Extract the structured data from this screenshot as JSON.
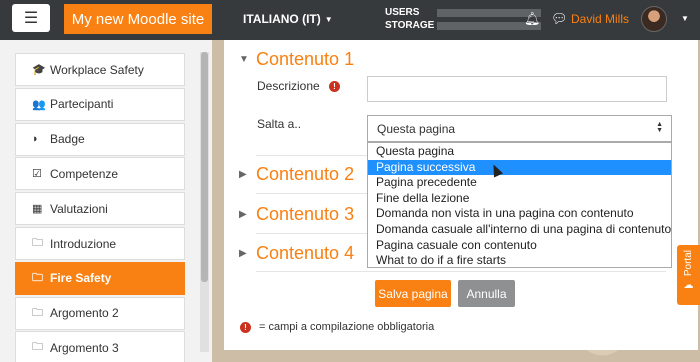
{
  "topbar": {
    "menu_icon": "hamburger-icon",
    "site_name": "My new Moodle site",
    "language": "ITALIANO (IT)",
    "usage": [
      {
        "label": "USERS"
      },
      {
        "label": "STORAGE"
      }
    ],
    "user_name": "David Mills"
  },
  "drawer": {
    "items": [
      {
        "icon": "graduation-cap-icon",
        "glyph": "🎓",
        "label": "Workplace Safety",
        "active": false
      },
      {
        "icon": "users-icon",
        "glyph": "👥",
        "label": "Partecipanti",
        "active": false
      },
      {
        "icon": "shield-icon",
        "glyph": "◗",
        "label": "Badge",
        "active": false
      },
      {
        "icon": "checkbox-icon",
        "glyph": "☑",
        "label": "Competenze",
        "active": false
      },
      {
        "icon": "table-icon",
        "glyph": "▦",
        "label": "Valutazioni",
        "active": false
      },
      {
        "icon": "folder-icon",
        "glyph": "🗀",
        "label": "Introduzione",
        "active": false
      },
      {
        "icon": "folder-icon",
        "glyph": "🗀",
        "label": "Fire Safety",
        "active": true
      },
      {
        "icon": "folder-icon",
        "glyph": "🗀",
        "label": "Argomento 2",
        "active": false
      },
      {
        "icon": "folder-icon",
        "glyph": "🗀",
        "label": "Argomento 3",
        "active": false
      }
    ]
  },
  "form": {
    "sections": [
      {
        "title": "Contenuto 1",
        "expanded": true
      },
      {
        "title": "Contenuto 2",
        "expanded": false
      },
      {
        "title": "Contenuto 3",
        "expanded": false
      },
      {
        "title": "Contenuto 4",
        "expanded": false
      }
    ],
    "description_label": "Descrizione",
    "description_value": "",
    "jump_label": "Salta a..",
    "jump_selected": "Questa pagina",
    "jump_options": [
      "Questa pagina",
      "Pagina successiva",
      "Pagina precedente",
      "Fine della lezione",
      "Domanda non vista in una pagina con contenuto",
      "Domanda casuale all'interno di una pagina di contenuto",
      "Pagina casuale con contenuto",
      "What to do if a fire starts"
    ],
    "highlighted_option": "Pagina successiva",
    "save_label": "Salva pagina",
    "cancel_label": "Annulla",
    "required_legend": "= campi a compilazione obbligatoria"
  },
  "portal": {
    "label": "Portal"
  },
  "colors": {
    "accent": "#f98012",
    "topbar": "#373a3c",
    "required": "#ca3120",
    "highlight": "#1e90ff"
  }
}
